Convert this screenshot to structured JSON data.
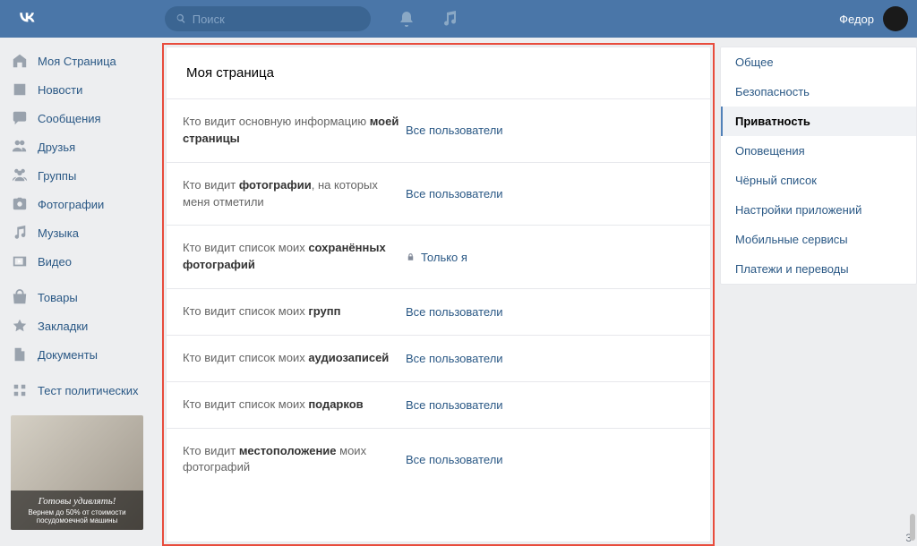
{
  "header": {
    "search_placeholder": "Поиск",
    "username": "Федор"
  },
  "left_nav": {
    "items": [
      {
        "label": "Моя Страница",
        "icon": "home"
      },
      {
        "label": "Новости",
        "icon": "news"
      },
      {
        "label": "Сообщения",
        "icon": "messages"
      },
      {
        "label": "Друзья",
        "icon": "friends"
      },
      {
        "label": "Группы",
        "icon": "groups"
      },
      {
        "label": "Фотографии",
        "icon": "photos"
      },
      {
        "label": "Музыка",
        "icon": "music"
      },
      {
        "label": "Видео",
        "icon": "video"
      }
    ],
    "items2": [
      {
        "label": "Товары",
        "icon": "market"
      },
      {
        "label": "Закладки",
        "icon": "bookmarks"
      },
      {
        "label": "Документы",
        "icon": "docs"
      }
    ],
    "items3": [
      {
        "label": "Тест политических",
        "icon": "apps"
      }
    ],
    "ad": {
      "title": "Готовы удивлять!",
      "subtitle": "Вернем до 50% от стоимости посудомоечной машины"
    }
  },
  "card": {
    "title": "Моя страница",
    "rows": [
      {
        "label_pre": "Кто видит основную информацию ",
        "label_bold": "моей страницы",
        "label_post": "",
        "value": "Все пользователи",
        "locked": false
      },
      {
        "label_pre": "Кто видит ",
        "label_bold": "фотографии",
        "label_post": ", на которых меня отметили",
        "value": "Все пользователи",
        "locked": false
      },
      {
        "label_pre": "Кто видит список моих ",
        "label_bold": "сохранённых фотографий",
        "label_post": "",
        "value": "Только я",
        "locked": true
      },
      {
        "label_pre": "Кто видит список моих ",
        "label_bold": "групп",
        "label_post": "",
        "value": "Все пользователи",
        "locked": false
      },
      {
        "label_pre": "Кто видит список моих ",
        "label_bold": "аудиозаписей",
        "label_post": "",
        "value": "Все пользователи",
        "locked": false
      },
      {
        "label_pre": "Кто видит список моих ",
        "label_bold": "подарков",
        "label_post": "",
        "value": "Все пользователи",
        "locked": false
      },
      {
        "label_pre": "Кто видит ",
        "label_bold": "местоположение",
        "label_post": " моих фотографий",
        "value": "Все пользователи",
        "locked": false
      }
    ]
  },
  "right_tabs": {
    "items": [
      {
        "label": "Общее",
        "active": false
      },
      {
        "label": "Безопасность",
        "active": false
      },
      {
        "label": "Приватность",
        "active": true
      },
      {
        "label": "Оповещения",
        "active": false
      },
      {
        "label": "Чёрный список",
        "active": false
      },
      {
        "label": "Настройки приложений",
        "active": false
      },
      {
        "label": "Мобильные сервисы",
        "active": false
      },
      {
        "label": "Платежи и переводы",
        "active": false
      }
    ]
  },
  "corner_text": "3"
}
